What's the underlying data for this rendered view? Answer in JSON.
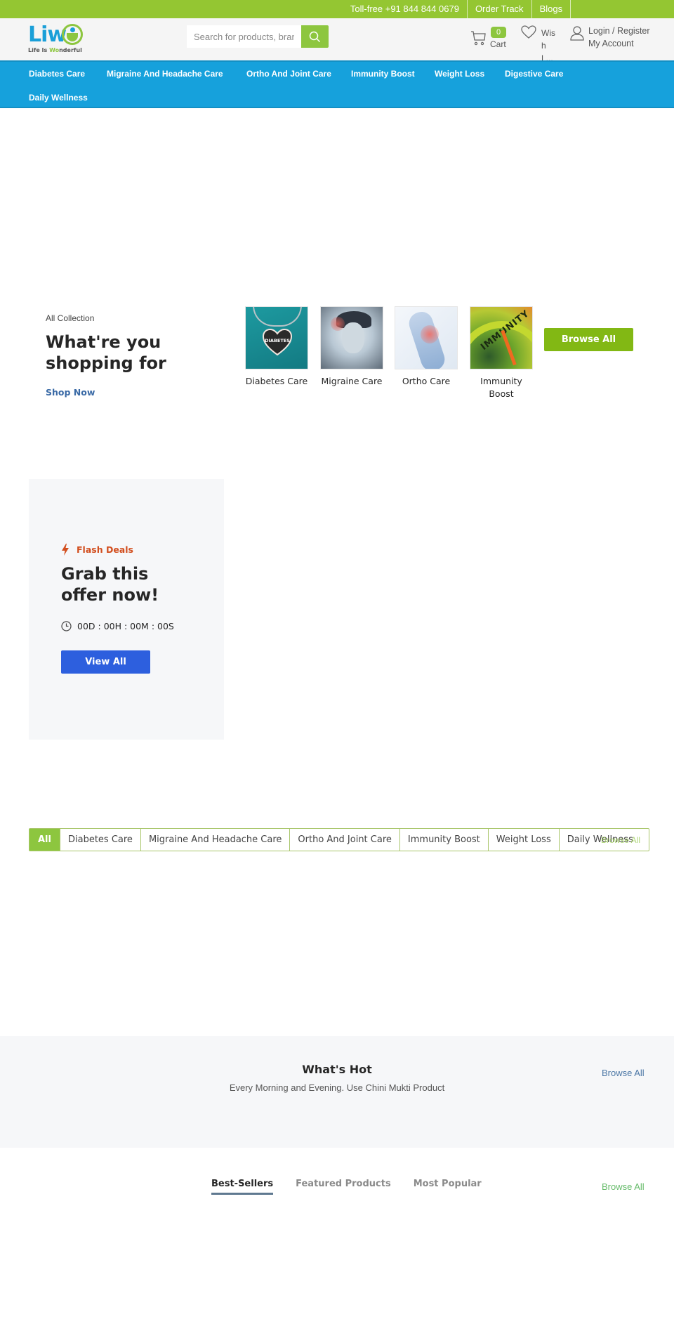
{
  "topbar": {
    "items": [
      "Toll-free +91 844 844 0679",
      "Order Track",
      "Blogs"
    ]
  },
  "header": {
    "logo": {
      "brand": "Liw",
      "tagline_pre": "Life Is ",
      "tagline_accent": "Wo",
      "tagline_post": "nderful"
    },
    "search": {
      "placeholder": "Search for products, brands",
      "value": ""
    },
    "cart": {
      "count": "0",
      "label": "Cart"
    },
    "wishlist": {
      "label": "Wish L..."
    },
    "account": {
      "line1": "Login / Register",
      "line2": "My Account"
    }
  },
  "nav": {
    "items": [
      "Diabetes Care",
      "Migraine And Headache Care",
      "Ortho And Joint Care",
      "Immunity Boost",
      "Weight Loss",
      "Digestive Care",
      "Daily Wellness"
    ]
  },
  "collection": {
    "eyebrow": "All Collection",
    "title": "What're you shopping for",
    "cta": "Shop Now",
    "categories": [
      {
        "name": "Diabetes Care",
        "image_text": "DIABETES"
      },
      {
        "name": "Migraine Care"
      },
      {
        "name": "Ortho Care"
      },
      {
        "name": "Immunity Boost",
        "image_text": "IMMUNITY"
      }
    ],
    "browse_all": "Browse All"
  },
  "flash_deals": {
    "label": "Flash Deals",
    "title": "Grab this offer now!",
    "timer": "00D :  00H :  00M :  00S",
    "button": "View All"
  },
  "category_tabs": {
    "items": [
      "All",
      "Diabetes Care",
      "Migraine And Headache Care",
      "Ortho And Joint Care",
      "Immunity Boost",
      "Weight Loss",
      "Daily Wellness"
    ],
    "active": "All",
    "browse_all": "Browse All"
  },
  "whats_hot": {
    "title": "What's Hot",
    "subtitle": "Every Morning and Evening. Use Chini Mukti Product",
    "browse_all": "Browse All"
  },
  "product_tabs": {
    "items": [
      "Best-Sellers",
      "Featured Products",
      "Most Popular"
    ],
    "active": "Best-Sellers",
    "browse_all": "Browse All"
  },
  "colors": {
    "brand_green": "#94c632",
    "nav_blue": "#16a1dc",
    "accent_green": "#82b814",
    "flash_orange": "#d24e1e",
    "cta_blue": "#2d5fde",
    "link_blue": "#3a6aa6"
  }
}
